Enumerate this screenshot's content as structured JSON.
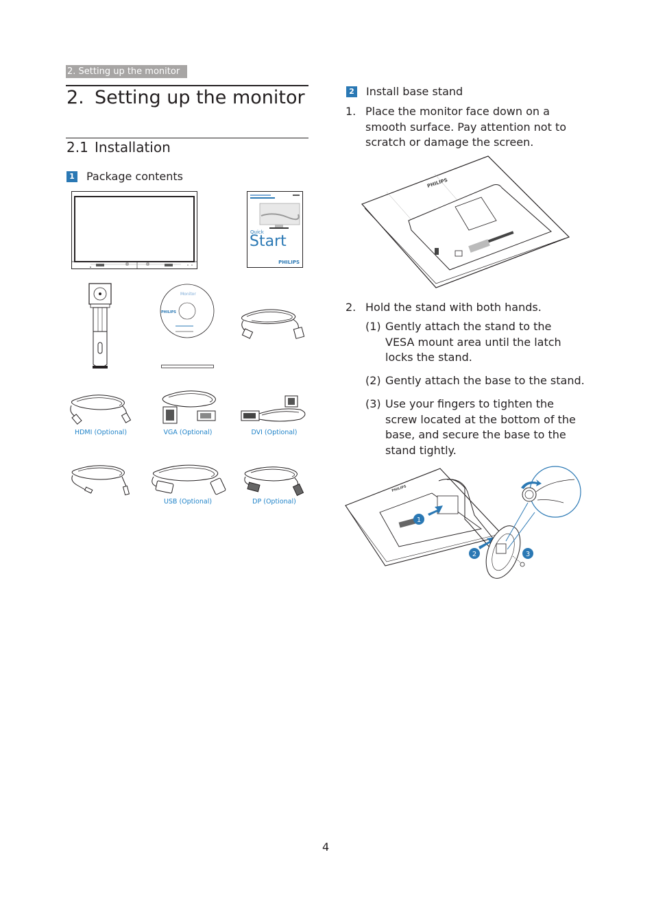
{
  "header": {
    "running_title": "2. Setting up the monitor"
  },
  "chapter": {
    "number": "2.",
    "title": "Setting up the monitor"
  },
  "section": {
    "number": "2.1",
    "title": "Installation"
  },
  "package_contents": {
    "badge": "1",
    "title": "Package contents",
    "booklet": {
      "line1": "Quick",
      "line2": "Start",
      "brand": "PHILIPS"
    },
    "cd": {
      "title": "Monitor",
      "brand": "PHILIPS"
    },
    "cables": [
      {
        "name": "hdmi",
        "label": "HDMI (Optional)"
      },
      {
        "name": "vga",
        "label": "VGA (Optional)"
      },
      {
        "name": "dvi",
        "label": "DVI (Optional)"
      },
      {
        "name": "audio",
        "label": ""
      },
      {
        "name": "usb",
        "label": "USB (Optional)"
      },
      {
        "name": "dp",
        "label": "DP (Optional)"
      }
    ]
  },
  "install_base": {
    "badge": "2",
    "title": "Install base stand",
    "steps": [
      {
        "num": "1.",
        "text": "Place the monitor face down on a smooth surface. Pay attention not to scratch or damage the screen."
      },
      {
        "num": "2.",
        "text": "Hold the stand with both hands.",
        "substeps": [
          {
            "num": "(1)",
            "text": "Gently attach the stand to the VESA mount area until the latch locks the stand."
          },
          {
            "num": "(2)",
            "text": "Gently attach the base to the stand."
          },
          {
            "num": "(3)",
            "text": "Use your fingers to tighten the screw located at the bottom of the base, and secure the base to the stand tightly."
          }
        ]
      }
    ],
    "callouts": [
      "1",
      "2",
      "3"
    ],
    "monitor_brand": "PHILIPS"
  },
  "footer": {
    "page_number": "4"
  },
  "colors": {
    "accent_blue": "#2a78b4",
    "caption_blue": "#1e82c8",
    "header_gray": "#a7a5a4",
    "text": "#231f20"
  }
}
